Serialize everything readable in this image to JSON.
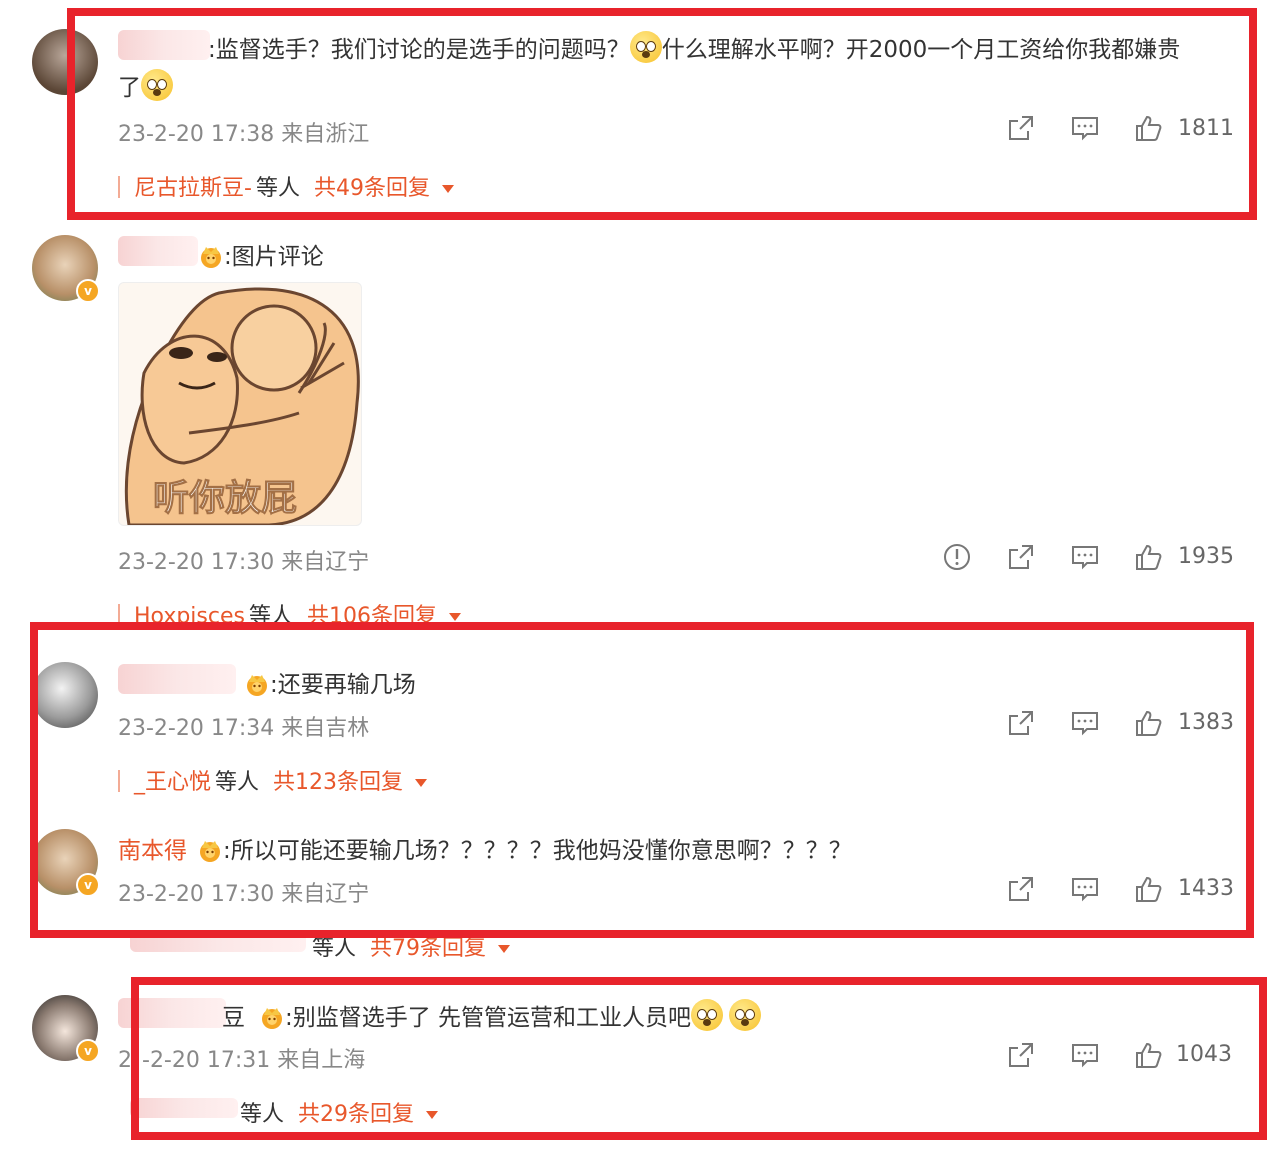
{
  "comments": [
    {
      "text": ":监督选手？我们讨论的是选手的问题吗？",
      "text_part2": "什么理解水平啊？开2000一个月工资给你我都嫌贵",
      "text_line2": "了",
      "meta": "23-2-20 17:38 来自浙江",
      "likes": "1811",
      "reply_name": "尼古拉斯豆-",
      "reply_mid": "等人",
      "reply_count": "共49条回复"
    },
    {
      "text": ":图片评论",
      "meme_caption": "听你放屁",
      "meta": "23-2-20 17:30 来自辽宁",
      "likes": "1935",
      "reply_name": "Hoxpisces",
      "reply_mid": "等人",
      "reply_count": "共106条回复"
    },
    {
      "text": ":还要再输几场",
      "meta": "23-2-20 17:34 来自吉林",
      "likes": "1383",
      "reply_name": "_王心悦",
      "reply_mid": "等人",
      "reply_count": "共123条回复"
    },
    {
      "username": "南本得",
      "text": ":所以可能还要输几场？？？？？我他妈没懂你意思啊？？？？",
      "meta": "23-2-20 17:30 来自辽宁",
      "likes": "1433",
      "reply_mid": "等人",
      "reply_count": "共79条回复"
    },
    {
      "username_tail": "豆",
      "text": ":别监督选手了 先管管运营和工业人员吧",
      "meta_prefix": "2",
      "meta": "-2-20 17:31 来自上海",
      "likes": "1043",
      "reply_mid": "等人",
      "reply_count": "共29条回复"
    }
  ],
  "icons": [
    "share-icon",
    "comment-icon",
    "like-icon",
    "report-icon"
  ],
  "colors": {
    "highlight_box": "#e8232b",
    "reply_accent": "#e8572b",
    "meta": "#888888"
  }
}
